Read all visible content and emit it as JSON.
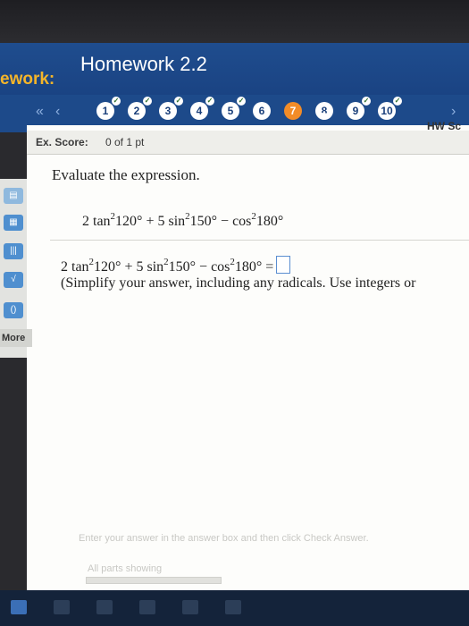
{
  "header": {
    "brand": "ework:",
    "title": "Homework 2.2"
  },
  "nav": {
    "first_icon": "double-chevron-left-icon",
    "prev_icon": "chevron-left-icon",
    "next_icon": "chevron-right-icon",
    "questions": [
      {
        "label": "1",
        "done": true
      },
      {
        "label": "2",
        "done": true
      },
      {
        "label": "3",
        "done": true
      },
      {
        "label": "4",
        "done": true
      },
      {
        "label": "5",
        "done": true
      },
      {
        "label": "6",
        "done": false
      },
      {
        "label": "7",
        "done": false,
        "current": true
      },
      {
        "label": "8",
        "done": false
      },
      {
        "label": "9",
        "done": true
      },
      {
        "label": "10",
        "done": true
      }
    ]
  },
  "score": {
    "hw_label": "HW Sc",
    "ex_label": "Ex. Score:",
    "ex_value": "0 of 1 pt"
  },
  "sidebar": {
    "more_label": "More"
  },
  "question": {
    "prompt": "Evaluate the expression.",
    "expr": {
      "a": "2 tan",
      "e1": "2",
      "b": "120° + 5 sin",
      "e2": "2",
      "c": "150° −  cos",
      "e3": "2",
      "d": "180°"
    },
    "answer_eq": "=",
    "instruction": "(Simplify your answer, including any radicals. Use integers or"
  },
  "footer": {
    "hint": "Enter your answer in the answer box and then click Check Answer.",
    "parts": "All parts showing",
    "progress": 0
  },
  "colors": {
    "header": "#1a4383",
    "accent": "#f28c28",
    "brand": "#f4b52a"
  }
}
